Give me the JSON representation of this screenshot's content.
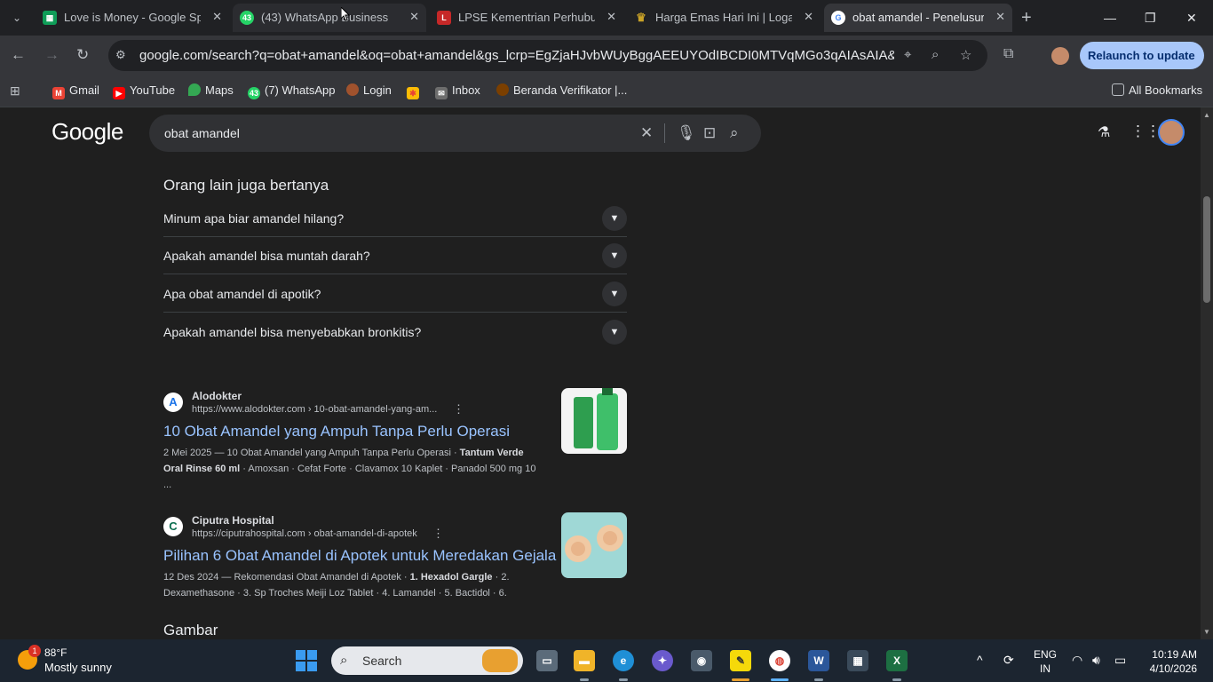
{
  "tabs": [
    {
      "title": "Love is Money - Google Spre",
      "favicon": "sheets-icon",
      "fav_text": "",
      "fav_color": "#0f9d58"
    },
    {
      "title": "(43) WhatsApp Business",
      "favicon": "whatsapp-icon",
      "fav_text": "43",
      "fav_color": "#25d366"
    },
    {
      "title": "LPSE Kementrian Perhubung",
      "favicon": "lpse-icon",
      "fav_text": "",
      "fav_color": "#c62828"
    },
    {
      "title": "Harga Emas Hari Ini | Logam",
      "favicon": "gold-icon",
      "fav_text": "",
      "fav_color": "#c9a227"
    },
    {
      "title": "obat amandel - Penelusuran",
      "favicon": "google-icon",
      "fav_text": "G",
      "fav_color": "#ffffff"
    }
  ],
  "address": {
    "url": "google.com/search?q=obat+amandel&oq=obat+amandel&gs_lcrp=EgZjaHJvbWUyBggAEEUYOdIBCDI0MTVqMGo3qAIAsAIA&sourcei..."
  },
  "relaunch_label": "Relaunch to update",
  "bookmarks": [
    {
      "label": "Gmail",
      "icon": "gmail-icon",
      "color": "#ea4335"
    },
    {
      "label": "YouTube",
      "icon": "youtube-icon",
      "color": "#ff0000"
    },
    {
      "label": "Maps",
      "icon": "maps-icon",
      "color": "#34a853"
    },
    {
      "label": "(7) WhatsApp",
      "icon": "whatsapp-icon",
      "color": "#25d366",
      "ic_text": "43"
    },
    {
      "label": "Login",
      "icon": "login-icon",
      "color": "#a0522d"
    },
    {
      "label": "",
      "icon": "photos-icon",
      "color": "#fbbc05"
    },
    {
      "label": "Inbox",
      "icon": "inbox-icon",
      "color": "#6d6d6d"
    },
    {
      "label": "Beranda Verifikator |...",
      "icon": "verifikator-icon",
      "color": "#7b3f00"
    }
  ],
  "all_bookmarks_label": "All Bookmarks",
  "google": {
    "logo": "Google",
    "query": "obat amandel"
  },
  "paa": {
    "title": "Orang lain juga bertanya",
    "questions": [
      "Minum apa biar amandel hilang?",
      "Apakah amandel bisa muntah darah?",
      "Apa obat amandel di apotik?",
      "Apakah amandel bisa menyebabkan bronkitis?"
    ]
  },
  "results": [
    {
      "source": "Alodokter",
      "source_icon_text": "A",
      "url": "https://www.alodokter.com › 10-obat-amandel-yang-am...",
      "title": "10 Obat Amandel yang Ampuh Tanpa Perlu Operasi",
      "snippet_a": "2 Mei 2025 — 10 Obat Amandel yang Ampuh Tanpa Perlu Operasi · ",
      "snippet_b": "Tantum Verde Oral Rinse 60 ml",
      "snippet_c": " · Amoxsan · Cefat Forte · Clavamox 10 Kaplet · Panadol 500 mg 10 ..."
    },
    {
      "source": "Ciputra Hospital",
      "source_icon_text": "C",
      "url": "https://ciputrahospital.com › obat-amandel-di-apotek",
      "title": "Pilihan 6 Obat Amandel di Apotek untuk Meredakan Gejala",
      "snippet_a": "12 Des 2024 — Rekomendasi Obat Amandel di Apotek · ",
      "snippet_b": "1. Hexadol Gargle",
      "snippet_c": " · 2. Dexamethasone · 3. Sp Troches Meiji Loz Tablet · 4. Lamandel · 5. Bactidol · 6."
    }
  ],
  "gambar_label": "Gambar",
  "taskbar": {
    "weather_temp": "88°F",
    "weather_cond": "Mostly sunny",
    "weather_badge": "1",
    "search_label": "Search",
    "lang_top": "ENG",
    "lang_bottom": "IN",
    "time": "10:19 AM",
    "date": "4/10/2026"
  }
}
